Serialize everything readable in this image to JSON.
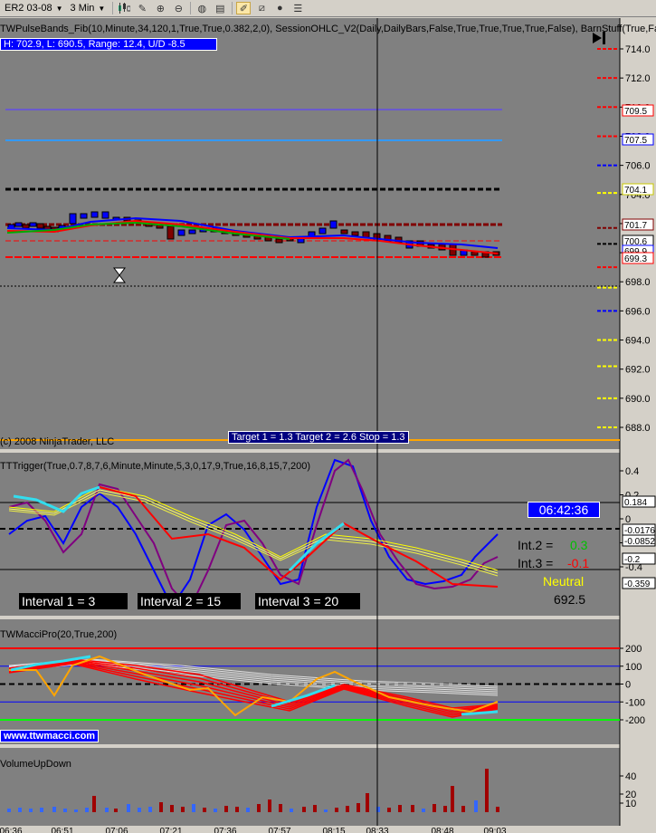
{
  "toolbar": {
    "instrument": "ER2 03-08",
    "interval": "3 Min"
  },
  "panel1": {
    "indicator_label": "TWPulseBands_Fib(10,Minute,34,120,1,True,True,0.382,2,0),  SessionOHLC_V2(Daily,DailyBars,False,True,True,True,True,False),  BarnStuff(True,Fal",
    "hl_box": "H: 702.9,  L: 690.5,  Range: 12.4,  U/D -8.5",
    "copyright": "(c) 2008 NinjaTrader, LLC",
    "target_box": "Target 1 = 1.3  Target 2 = 2.6  Stop = 1.3",
    "axis_ticks": [
      "714.0",
      "712.0",
      "710.0",
      "708.0",
      "706.0",
      "704.0",
      "702.0",
      "700.0",
      "698.0",
      "696.0",
      "694.0",
      "692.0",
      "690.0",
      "688.0"
    ],
    "price_boxes": [
      {
        "text": "709.5",
        "color": "#ff0000"
      },
      {
        "text": "707.5",
        "color": "#0000ff"
      },
      {
        "text": "704.1",
        "color": "#c8c800"
      },
      {
        "text": "701.7",
        "color": "#800000"
      },
      {
        "text": "700.6",
        "color": "#000000"
      },
      {
        "text": "699.9",
        "color": "#0000ff"
      },
      {
        "text": "699.3",
        "color": "#ff0000"
      }
    ]
  },
  "panel2": {
    "indicator_label": "TTTrigger(True,0.7,8,7,6,Minute,Minute,5,3,0,17,9,True,16,8,15,7,200)",
    "axis_ticks": [
      "0.4",
      "0.2",
      "0",
      "-0.2",
      "-0.4"
    ],
    "value_boxes": [
      "0.184",
      "-0.0176",
      "-0.0852",
      "-0.2",
      "-0.359"
    ],
    "clock": "06:42:36",
    "intervals": [
      "Interval 1 = 3",
      "Interval 2 = 15",
      "Interval 3 = 20"
    ],
    "int2_label": "Int.2 =",
    "int2_value": "0.3",
    "int3_label": "Int.3 =",
    "int3_value": "-0.1",
    "status": "Neutral",
    "price": "692.5"
  },
  "panel3": {
    "indicator_label": "TWMacciPro(20,True,200)",
    "website": "www.ttwmacci.com",
    "axis_ticks": [
      "200",
      "100",
      "0",
      "-100",
      "-200"
    ]
  },
  "panel4": {
    "indicator_label": "VolumeUpDown",
    "axis_ticks": [
      "40",
      "20",
      "10"
    ]
  },
  "time_axis": [
    "06:36",
    "06:51",
    "07:06",
    "07:21",
    "07:36",
    "07:57",
    "08:15",
    "08:33",
    "08:48",
    "09:03"
  ],
  "colors": {
    "background": "#808080",
    "up": "#0000ff",
    "down": "#ff0000",
    "target": "#000080",
    "neutral": "#ffff00"
  }
}
